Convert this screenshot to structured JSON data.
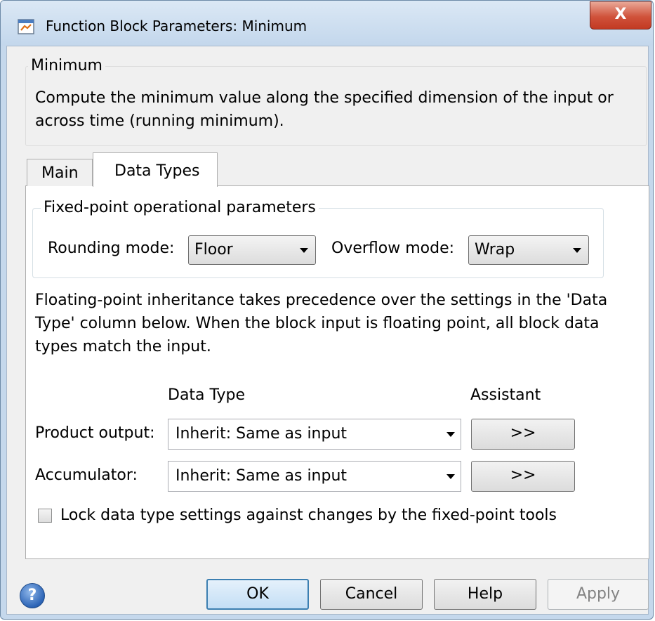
{
  "window": {
    "title": "Function Block Parameters: Minimum",
    "close_label": "X"
  },
  "block": {
    "name": "Minimum",
    "description_lines": [
      "Compute the minimum value along the specified dimension of the input or",
      "across time (running minimum)."
    ]
  },
  "tabs": [
    {
      "label": "Main",
      "selected": false
    },
    {
      "label": "Data Types",
      "selected": true
    }
  ],
  "fixed_point": {
    "group_label": "Fixed-point operational parameters",
    "rounding_label": "Rounding mode:",
    "rounding_value": "Floor",
    "overflow_label": "Overflow mode:",
    "overflow_value": "Wrap"
  },
  "note_lines": [
    "Floating-point inheritance takes precedence over the settings in the 'Data",
    "Type' column below. When the block input is floating point, all block data",
    "types match the input."
  ],
  "table": {
    "col_data_type": "Data Type",
    "col_assistant": "Assistant",
    "rows": [
      {
        "label": "Product output:",
        "value": "Inherit: Same as input",
        "assistant": ">>"
      },
      {
        "label": "Accumulator:",
        "value": "Inherit: Same as input",
        "assistant": ">>"
      }
    ]
  },
  "lock": {
    "label": "Lock data type settings against changes by the fixed-point tools",
    "checked": false
  },
  "buttons": {
    "help_icon": "?",
    "ok": "OK",
    "cancel": "Cancel",
    "help": "Help",
    "apply": "Apply"
  },
  "icons": [
    "block-parameters-app-icon",
    "close-icon",
    "chevron-down-icon",
    "help-circle-icon"
  ],
  "colors": {
    "title_bar": "#c3d7ec",
    "close_button": "#c94a33",
    "default_button_border": "#3c7fb1"
  }
}
